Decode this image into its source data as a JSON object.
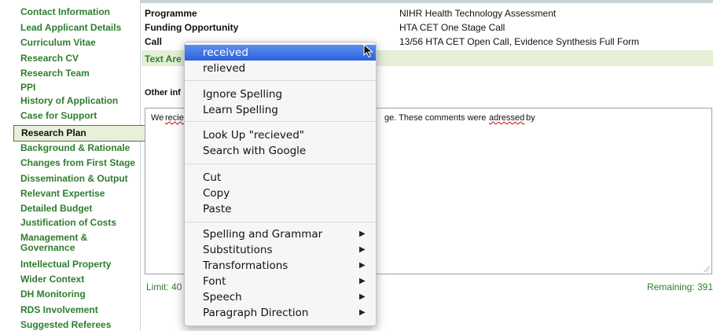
{
  "sidebar": {
    "items": [
      {
        "label": "Contact Information"
      },
      {
        "label": "Lead Applicant Details"
      },
      {
        "label": "Curriculum Vitae"
      },
      {
        "label": "Research CV"
      },
      {
        "label": "Research Team"
      },
      {
        "label": "PPI"
      },
      {
        "label": "History of Application"
      },
      {
        "label": "Case for Support"
      },
      {
        "label": "Research Plan"
      },
      {
        "label": "Background & Rationale"
      },
      {
        "label": "Changes from First Stage"
      },
      {
        "label": "Dissemination & Output"
      },
      {
        "label": "Relevant Expertise"
      },
      {
        "label": "Detailed Budget"
      },
      {
        "label": "Justification of Costs"
      },
      {
        "label": "Management & Governance"
      },
      {
        "label": "Intellectual Property"
      },
      {
        "label": "Wider Context"
      },
      {
        "label": "DH Monitoring"
      },
      {
        "label": "RDS Involvement"
      },
      {
        "label": "Suggested Referees"
      }
    ],
    "active_label": "Research Plan"
  },
  "info": {
    "programme_label": "Programme",
    "programme_value": "NIHR Health Technology Assessment",
    "funding_label": "Funding Opportunity",
    "funding_value": "HTA CET One Stage Call",
    "call_label": "Call",
    "call_value": "13/56 HTA CET Open Call, Evidence Synthesis Full Form",
    "band_label": "Text Are",
    "other_label": "Other inf"
  },
  "textarea": {
    "prefix": "We ",
    "misspelt_word": "recie",
    "rest": "ge. These comments were ",
    "misspelt_word2": "adressed",
    "suffix": " by"
  },
  "footer": {
    "limit": "Limit: 40",
    "remaining": "Remaining: 391"
  },
  "context_menu": {
    "suggestions": [
      "received",
      "relieved"
    ],
    "ignore_spelling": "Ignore Spelling",
    "learn_spelling": "Learn Spelling",
    "look_up": "Look Up \"recieved\"",
    "search_google": "Search with Google",
    "cut": "Cut",
    "copy": "Copy",
    "paste": "Paste",
    "submenus": [
      "Spelling and Grammar",
      "Substitutions",
      "Transformations",
      "Font",
      "Speech",
      "Paragraph Direction"
    ],
    "arrow": "▶"
  },
  "colors": {
    "sidebar_link": "#2e7d2e",
    "highlight": "#2d62d9",
    "band": "#e4efd6"
  }
}
